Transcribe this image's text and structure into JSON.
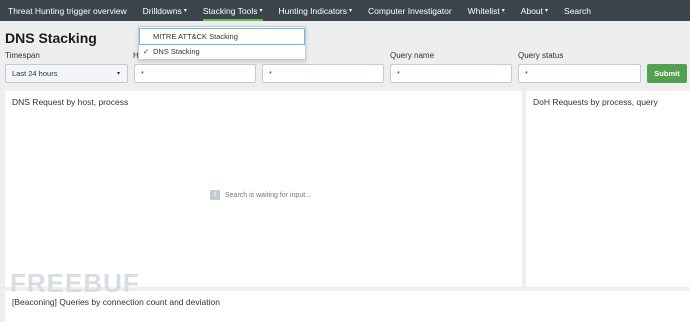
{
  "navbar": {
    "items": [
      {
        "label": "Threat Hunting trigger overview",
        "caret": false
      },
      {
        "label": "Drilldowns",
        "caret": true
      },
      {
        "label": "Stacking Tools",
        "caret": true
      },
      {
        "label": "Hunting Indicators",
        "caret": true
      },
      {
        "label": "Computer Investigator",
        "caret": false
      },
      {
        "label": "Whitelist",
        "caret": true
      },
      {
        "label": "About",
        "caret": true
      },
      {
        "label": "Search",
        "caret": false
      }
    ],
    "caret_glyph": "▾",
    "active_color": "#5cc05c"
  },
  "page": {
    "title": "DNS Stacking"
  },
  "filters": {
    "timespan": {
      "label": "Timespan",
      "value": "Last 24 hours"
    },
    "host": {
      "label": "H",
      "value": "*"
    },
    "field3": {
      "value": "*"
    },
    "query_name": {
      "label": "Query name",
      "value": "*"
    },
    "query_status": {
      "label": "Query status",
      "value": "*"
    },
    "submit_label": "Submit"
  },
  "dropdown": {
    "items": [
      {
        "label": "MITRE ATT&CK Stacking",
        "checked": false
      },
      {
        "label": "DNS Stacking",
        "checked": true
      }
    ],
    "check_glyph": "✓"
  },
  "panels": {
    "dns_requests": {
      "title": "DNS Request by host, process",
      "waiting_index": "1",
      "waiting_text": "Search is waiting for input..."
    },
    "doh_requests": {
      "title": "DoH Requests by process, query"
    },
    "beaconing": {
      "title": "[Beaconing] Queries by connection count and deviation"
    }
  },
  "watermark": "FREEBUF"
}
